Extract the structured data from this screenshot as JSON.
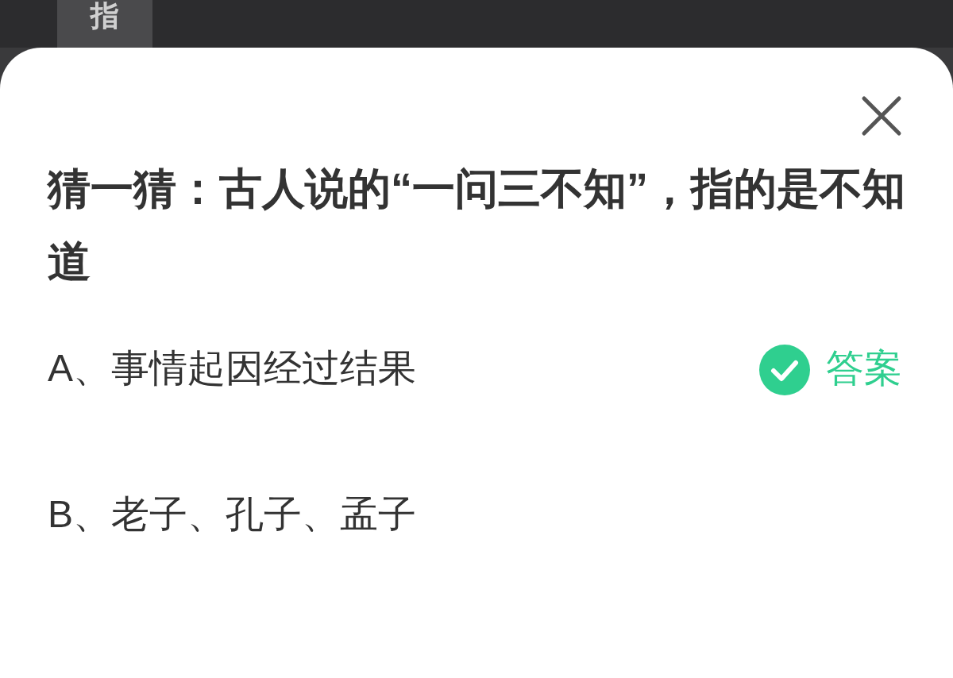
{
  "background": {
    "text": "指"
  },
  "dialog": {
    "question": "猜一猜：古人说的“一问三不知”，指的是不知道",
    "options": [
      {
        "label": "A、事情起因经过结果",
        "correct": true,
        "answer_label": "答案"
      },
      {
        "label": "B、老子、孔子、孟子",
        "correct": false
      }
    ]
  }
}
